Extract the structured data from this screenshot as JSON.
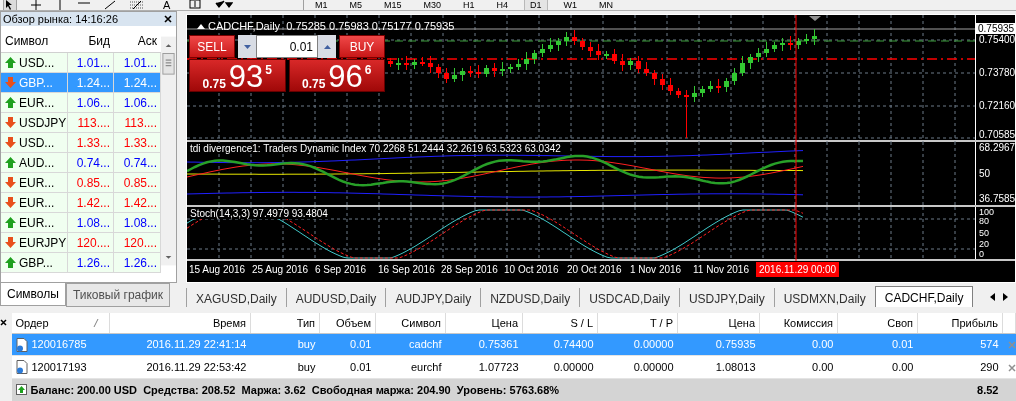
{
  "toolbar": {
    "tools": [
      {
        "kind": "cursor",
        "selected": true
      },
      {
        "kind": "crosshair",
        "selected": false
      },
      {
        "kind": "vline",
        "selected": false
      },
      {
        "kind": "hline",
        "selected": false
      },
      {
        "kind": "trend",
        "selected": false
      },
      {
        "kind": "channel",
        "selected": false
      },
      {
        "kind": "text",
        "label": "A",
        "selected": false
      },
      {
        "kind": "label",
        "selected": false
      },
      {
        "kind": "arrows",
        "selected": false
      }
    ],
    "timeframes": [
      {
        "label": "M1",
        "selected": false
      },
      {
        "label": "M5",
        "selected": false
      },
      {
        "label": "M15",
        "selected": false
      },
      {
        "label": "M30",
        "selected": false
      },
      {
        "label": "H1",
        "selected": false
      },
      {
        "label": "H4",
        "selected": false
      },
      {
        "label": "D1",
        "selected": true
      },
      {
        "label": "W1",
        "selected": false
      },
      {
        "label": "MN",
        "selected": false
      }
    ]
  },
  "market_watch": {
    "title": "Обзор рынка: 14:16:26",
    "columns": [
      "Символ",
      "Бид",
      "Аск"
    ],
    "rows": [
      {
        "symbol": "USD...",
        "bid": "1.01...",
        "ask": "1.01...",
        "rising": true,
        "selected": false
      },
      {
        "symbol": "GBP...",
        "bid": "1.24...",
        "ask": "1.24...",
        "rising": false,
        "selected": true
      },
      {
        "symbol": "EUR...",
        "bid": "1.06...",
        "ask": "1.06...",
        "rising": true,
        "selected": false
      },
      {
        "symbol": "USDJPY",
        "bid": "113....",
        "ask": "113....",
        "rising": false,
        "selected": false
      },
      {
        "symbol": "USD...",
        "bid": "1.33...",
        "ask": "1.33...",
        "rising": false,
        "selected": false
      },
      {
        "symbol": "AUD...",
        "bid": "0.74...",
        "ask": "0.74...",
        "rising": true,
        "selected": false
      },
      {
        "symbol": "EUR...",
        "bid": "0.85...",
        "ask": "0.85...",
        "rising": false,
        "selected": false
      },
      {
        "symbol": "EUR...",
        "bid": "1.42...",
        "ask": "1.42...",
        "rising": false,
        "selected": false
      },
      {
        "symbol": "EUR...",
        "bid": "1.08...",
        "ask": "1.08...",
        "rising": true,
        "selected": false
      },
      {
        "symbol": "EURJPY",
        "bid": "120....",
        "ask": "120....",
        "rising": false,
        "selected": false
      },
      {
        "symbol": "GBP...",
        "bid": "1.26...",
        "ask": "1.26...",
        "rising": true,
        "selected": false
      }
    ],
    "tabs": [
      {
        "label": "Символы",
        "selected": true
      },
      {
        "label": "Тиковый график",
        "selected": false
      }
    ]
  },
  "chart": {
    "title": "CADCHF,Daily  0.75285 0.75983 0.75177 0.75935",
    "trade_panel": {
      "sell_label": "SELL",
      "buy_label": "BUY",
      "lot": "0.01",
      "sell_price": {
        "prefix": "0.75",
        "big": "93",
        "sup": "5"
      },
      "buy_price": {
        "prefix": "0.75",
        "big": "96",
        "sup": "6"
      }
    },
    "price_axis": [
      {
        "label": "0.75935",
        "kind": "current"
      },
      {
        "label": "0.75400",
        "kind": "level"
      },
      {
        "label": "0.73780",
        "kind": "level"
      },
      {
        "label": "0.72160",
        "kind": "level"
      },
      {
        "label": "0.70585",
        "kind": "level"
      }
    ],
    "indicator_1": {
      "title": "tdi divergence1: Traders Dynamic Index 70.2268 51.2444 32.2619 63.5323 63.0342",
      "axis": [
        "68.2967",
        "50",
        "36.7585"
      ]
    },
    "indicator_2": {
      "title": "Stoch(14,3,3) 97.4979 93.4804",
      "axis": [
        "100",
        "80",
        "50",
        "20",
        "0"
      ]
    },
    "date_axis": [
      "15 Aug 2016",
      "25 Aug 2016",
      "6 Sep 2016",
      "16 Sep 2016",
      "28 Sep 2016",
      "10 Oct 2016",
      "20 Oct 2016",
      "1 Nov 2016",
      "11 Nov 2016"
    ],
    "cursor_date": "2016.11.29 00:00"
  },
  "chart_tabs": [
    {
      "label": "XAGUSD,Daily",
      "selected": false
    },
    {
      "label": "AUDUSD,Daily",
      "selected": false
    },
    {
      "label": "AUDJPY,Daily",
      "selected": false
    },
    {
      "label": "NZDUSD,Daily",
      "selected": false
    },
    {
      "label": "USDCAD,Daily",
      "selected": false
    },
    {
      "label": "USDJPY,Daily",
      "selected": false
    },
    {
      "label": "USDMXN,Daily",
      "selected": false
    },
    {
      "label": "CADCHF,Daily",
      "selected": true
    }
  ],
  "terminal": {
    "columns": [
      "Ордер",
      "Время",
      "Тип",
      "Объем",
      "Символ",
      "Цена",
      "S / L",
      "T / P",
      "Цена",
      "Комиссия",
      "Своп",
      "Прибыль"
    ],
    "orders": [
      {
        "order": "120016785",
        "time": "2016.11.29 22:41:14",
        "type": "buy",
        "volume": "0.01",
        "symbol": "cadchf",
        "open_price": "0.75361",
        "sl": "0.74400",
        "tp": "0.00000",
        "price": "0.75935",
        "commission": "0.00",
        "swap": "0.01",
        "profit": "574",
        "selected": true
      },
      {
        "order": "120017193",
        "time": "2016.11.29 22:53:42",
        "type": "buy",
        "volume": "0.01",
        "symbol": "eurchf",
        "open_price": "1.07723",
        "sl": "0.00000",
        "tp": "0.00000",
        "price": "1.08013",
        "commission": "0.00",
        "swap": "0.00",
        "profit": "290",
        "selected": false
      }
    ],
    "summary": "Баланс: 200.00 USD  Средства: 208.52  Маржа: 3.62  Свободная маржа: 204.90  Уровень: 5763.68%",
    "total": "8.52"
  }
}
